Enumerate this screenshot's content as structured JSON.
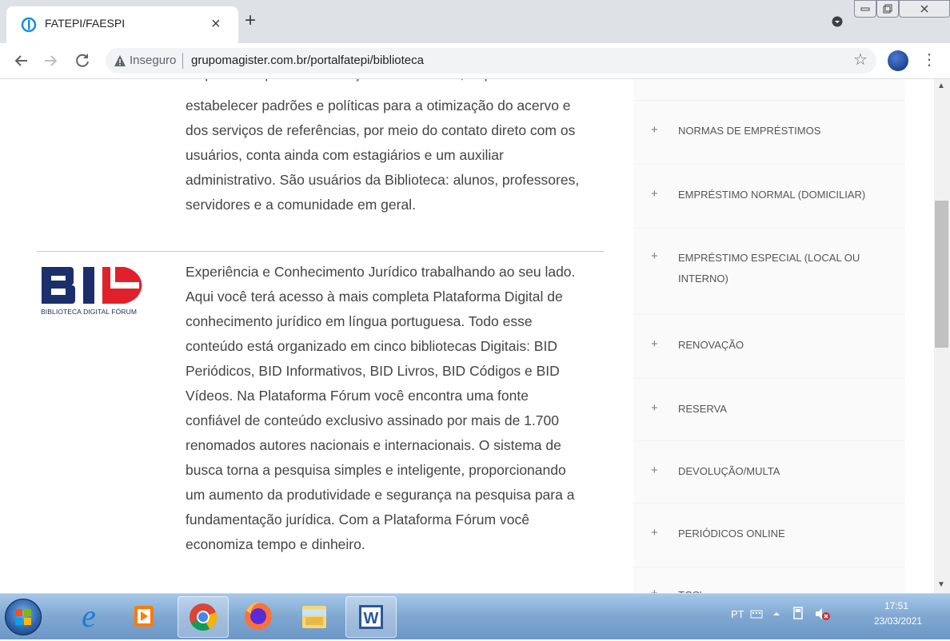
{
  "browser": {
    "tab_title": "FATEPI/FAESPI",
    "tab_close": "×",
    "new_tab": "+",
    "insecure_label": "Inseguro",
    "url": "grupomagister.com.br/portalfatepi/biblioteca",
    "accent": "#1a73e8"
  },
  "content": {
    "intro_lines": [
      "estabelecer padrões e políticas para a otimização do acervo e",
      "dos serviços de referências, por meio do contato direto com os",
      "usuários, conta ainda com estagiários e um auxiliar",
      "administrativo. São usuários da Biblioteca: alunos, professores,",
      "servidores e a comunidade em geral."
    ],
    "bid": {
      "logo_text": "BID",
      "caption": "BIBLIOTECA DIGITAL FÓRUM",
      "colors": {
        "navy": "#1b2f6b",
        "red": "#e0212b"
      },
      "lines": [
        "Experiência e Conhecimento Jurídico trabalhando ao seu lado.",
        "Aqui você terá acesso à mais completa Plataforma Digital de",
        "conhecimento jurídico em língua portuguesa. Todo esse",
        "conteúdo está organizado em cinco bibliotecas Digitais: BID",
        "Periódicos, BID Informativos, BID Livros, BID Códigos e BID",
        "Vídeos. Na Plataforma Fórum você encontra uma fonte",
        "confiável de conteúdo exclusivo assinado por mais de 1.700",
        "renomados autores nacionais e internacionais. O sistema de",
        "busca torna a pesquisa simples e inteligente, proporcionando",
        "um aumento da produtividade e segurança na pesquisa para a",
        "fundamentação jurídica. Com a Plataforma Fórum você",
        "economiza tempo e dinheiro."
      ]
    }
  },
  "sidebar": {
    "items": [
      {
        "plus": "+",
        "label": "NORMAS DE EMPRÉSTIMOS"
      },
      {
        "plus": "+",
        "label": "EMPRÉSTIMO NORMAL (DOMICILIAR)"
      },
      {
        "plus": "+",
        "label": "EMPRÉSTIMO ESPECIAL (LOCAL OU INTERNO)"
      },
      {
        "plus": "+",
        "label": "RENOVAÇÃO"
      },
      {
        "plus": "+",
        "label": "RESERVA"
      },
      {
        "plus": "+",
        "label": "DEVOLUÇÃO/MULTA"
      },
      {
        "plus": "+",
        "label": "PERIÓDICOS ONLINE"
      },
      {
        "plus": "+",
        "label": "TCC's"
      }
    ]
  },
  "taskbar": {
    "language": "PT",
    "time": "17:51",
    "date": "23/03/2021"
  }
}
